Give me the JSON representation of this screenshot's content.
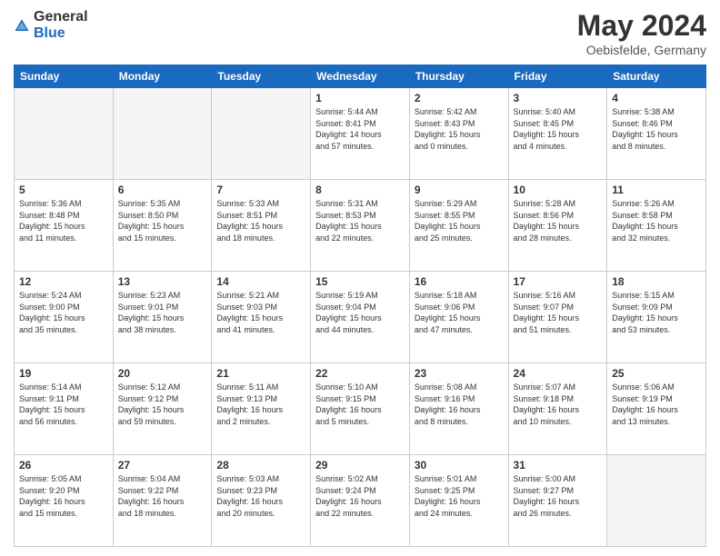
{
  "logo": {
    "general": "General",
    "blue": "Blue"
  },
  "title": "May 2024",
  "subtitle": "Oebisfelde, Germany",
  "headers": [
    "Sunday",
    "Monday",
    "Tuesday",
    "Wednesday",
    "Thursday",
    "Friday",
    "Saturday"
  ],
  "weeks": [
    [
      {
        "num": "",
        "info": "",
        "empty": true
      },
      {
        "num": "",
        "info": "",
        "empty": true
      },
      {
        "num": "",
        "info": "",
        "empty": true
      },
      {
        "num": "1",
        "info": "Sunrise: 5:44 AM\nSunset: 8:41 PM\nDaylight: 14 hours\nand 57 minutes."
      },
      {
        "num": "2",
        "info": "Sunrise: 5:42 AM\nSunset: 8:43 PM\nDaylight: 15 hours\nand 0 minutes."
      },
      {
        "num": "3",
        "info": "Sunrise: 5:40 AM\nSunset: 8:45 PM\nDaylight: 15 hours\nand 4 minutes."
      },
      {
        "num": "4",
        "info": "Sunrise: 5:38 AM\nSunset: 8:46 PM\nDaylight: 15 hours\nand 8 minutes."
      }
    ],
    [
      {
        "num": "5",
        "info": "Sunrise: 5:36 AM\nSunset: 8:48 PM\nDaylight: 15 hours\nand 11 minutes."
      },
      {
        "num": "6",
        "info": "Sunrise: 5:35 AM\nSunset: 8:50 PM\nDaylight: 15 hours\nand 15 minutes."
      },
      {
        "num": "7",
        "info": "Sunrise: 5:33 AM\nSunset: 8:51 PM\nDaylight: 15 hours\nand 18 minutes."
      },
      {
        "num": "8",
        "info": "Sunrise: 5:31 AM\nSunset: 8:53 PM\nDaylight: 15 hours\nand 22 minutes."
      },
      {
        "num": "9",
        "info": "Sunrise: 5:29 AM\nSunset: 8:55 PM\nDaylight: 15 hours\nand 25 minutes."
      },
      {
        "num": "10",
        "info": "Sunrise: 5:28 AM\nSunset: 8:56 PM\nDaylight: 15 hours\nand 28 minutes."
      },
      {
        "num": "11",
        "info": "Sunrise: 5:26 AM\nSunset: 8:58 PM\nDaylight: 15 hours\nand 32 minutes."
      }
    ],
    [
      {
        "num": "12",
        "info": "Sunrise: 5:24 AM\nSunset: 9:00 PM\nDaylight: 15 hours\nand 35 minutes."
      },
      {
        "num": "13",
        "info": "Sunrise: 5:23 AM\nSunset: 9:01 PM\nDaylight: 15 hours\nand 38 minutes."
      },
      {
        "num": "14",
        "info": "Sunrise: 5:21 AM\nSunset: 9:03 PM\nDaylight: 15 hours\nand 41 minutes."
      },
      {
        "num": "15",
        "info": "Sunrise: 5:19 AM\nSunset: 9:04 PM\nDaylight: 15 hours\nand 44 minutes."
      },
      {
        "num": "16",
        "info": "Sunrise: 5:18 AM\nSunset: 9:06 PM\nDaylight: 15 hours\nand 47 minutes."
      },
      {
        "num": "17",
        "info": "Sunrise: 5:16 AM\nSunset: 9:07 PM\nDaylight: 15 hours\nand 51 minutes."
      },
      {
        "num": "18",
        "info": "Sunrise: 5:15 AM\nSunset: 9:09 PM\nDaylight: 15 hours\nand 53 minutes."
      }
    ],
    [
      {
        "num": "19",
        "info": "Sunrise: 5:14 AM\nSunset: 9:11 PM\nDaylight: 15 hours\nand 56 minutes."
      },
      {
        "num": "20",
        "info": "Sunrise: 5:12 AM\nSunset: 9:12 PM\nDaylight: 15 hours\nand 59 minutes."
      },
      {
        "num": "21",
        "info": "Sunrise: 5:11 AM\nSunset: 9:13 PM\nDaylight: 16 hours\nand 2 minutes."
      },
      {
        "num": "22",
        "info": "Sunrise: 5:10 AM\nSunset: 9:15 PM\nDaylight: 16 hours\nand 5 minutes."
      },
      {
        "num": "23",
        "info": "Sunrise: 5:08 AM\nSunset: 9:16 PM\nDaylight: 16 hours\nand 8 minutes."
      },
      {
        "num": "24",
        "info": "Sunrise: 5:07 AM\nSunset: 9:18 PM\nDaylight: 16 hours\nand 10 minutes."
      },
      {
        "num": "25",
        "info": "Sunrise: 5:06 AM\nSunset: 9:19 PM\nDaylight: 16 hours\nand 13 minutes."
      }
    ],
    [
      {
        "num": "26",
        "info": "Sunrise: 5:05 AM\nSunset: 9:20 PM\nDaylight: 16 hours\nand 15 minutes."
      },
      {
        "num": "27",
        "info": "Sunrise: 5:04 AM\nSunset: 9:22 PM\nDaylight: 16 hours\nand 18 minutes."
      },
      {
        "num": "28",
        "info": "Sunrise: 5:03 AM\nSunset: 9:23 PM\nDaylight: 16 hours\nand 20 minutes."
      },
      {
        "num": "29",
        "info": "Sunrise: 5:02 AM\nSunset: 9:24 PM\nDaylight: 16 hours\nand 22 minutes."
      },
      {
        "num": "30",
        "info": "Sunrise: 5:01 AM\nSunset: 9:25 PM\nDaylight: 16 hours\nand 24 minutes."
      },
      {
        "num": "31",
        "info": "Sunrise: 5:00 AM\nSunset: 9:27 PM\nDaylight: 16 hours\nand 26 minutes."
      },
      {
        "num": "",
        "info": "",
        "empty": true
      }
    ]
  ]
}
